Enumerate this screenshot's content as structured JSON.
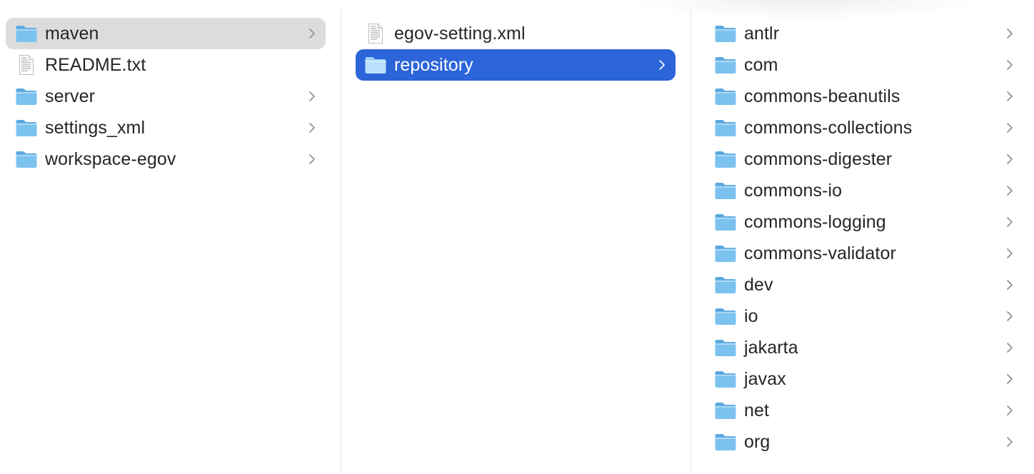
{
  "columns": [
    {
      "items": [
        {
          "label": "maven",
          "type": "folder",
          "has_children": true,
          "state": "selected-inactive"
        },
        {
          "label": "README.txt",
          "type": "file",
          "has_children": false,
          "state": "normal"
        },
        {
          "label": "server",
          "type": "folder",
          "has_children": true,
          "state": "normal"
        },
        {
          "label": "settings_xml",
          "type": "folder",
          "has_children": true,
          "state": "normal"
        },
        {
          "label": "workspace-egov",
          "type": "folder",
          "has_children": true,
          "state": "normal"
        }
      ]
    },
    {
      "items": [
        {
          "label": "egov-setting.xml",
          "type": "file",
          "has_children": false,
          "state": "normal"
        },
        {
          "label": "repository",
          "type": "folder",
          "has_children": true,
          "state": "selected-active"
        }
      ]
    },
    {
      "items": [
        {
          "label": "antlr",
          "type": "folder",
          "has_children": true,
          "state": "normal"
        },
        {
          "label": "com",
          "type": "folder",
          "has_children": true,
          "state": "normal"
        },
        {
          "label": "commons-beanutils",
          "type": "folder",
          "has_children": true,
          "state": "normal"
        },
        {
          "label": "commons-collections",
          "type": "folder",
          "has_children": true,
          "state": "normal"
        },
        {
          "label": "commons-digester",
          "type": "folder",
          "has_children": true,
          "state": "normal"
        },
        {
          "label": "commons-io",
          "type": "folder",
          "has_children": true,
          "state": "normal"
        },
        {
          "label": "commons-logging",
          "type": "folder",
          "has_children": true,
          "state": "normal"
        },
        {
          "label": "commons-validator",
          "type": "folder",
          "has_children": true,
          "state": "normal"
        },
        {
          "label": "dev",
          "type": "folder",
          "has_children": true,
          "state": "normal"
        },
        {
          "label": "io",
          "type": "folder",
          "has_children": true,
          "state": "normal"
        },
        {
          "label": "jakarta",
          "type": "folder",
          "has_children": true,
          "state": "normal"
        },
        {
          "label": "javax",
          "type": "folder",
          "has_children": true,
          "state": "normal"
        },
        {
          "label": "net",
          "type": "folder",
          "has_children": true,
          "state": "normal"
        },
        {
          "label": "org",
          "type": "folder",
          "has_children": true,
          "state": "normal"
        }
      ]
    }
  ],
  "icons": {
    "folder": "folder-icon",
    "file": "document-icon",
    "chevron": "chevron-right-icon"
  },
  "colors": {
    "selection_active": "#2c65d9",
    "selection_inactive": "#dcdcdc",
    "folder_body": "#7cc2ef",
    "folder_tab": "#5aa8df",
    "text": "#262626",
    "chevron": "#8e8e8e"
  }
}
